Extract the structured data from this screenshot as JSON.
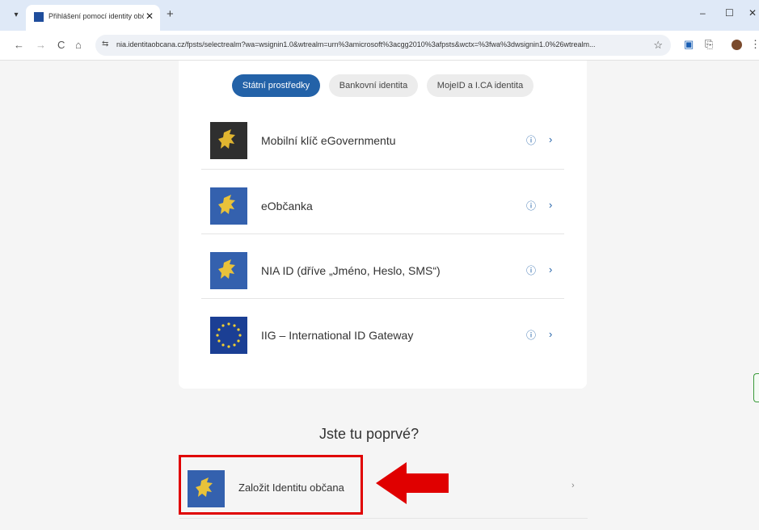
{
  "browser": {
    "tab_title": "Přihlášení pomocí identity obča",
    "tab_close": "✕",
    "new_tab": "+",
    "url": "nia.identitaobcana.cz/fpsts/selectrealm?wa=wsignin1.0&wtrealm=urn%3amicrosoft%3acgg2010%3afpsts&wctx=%3fwa%3dwsignin1.0%26wtrealm...",
    "win_min": "–",
    "win_max": "☐",
    "win_close": "✕",
    "tab_dropdown": "▾",
    "nav_back": "←",
    "nav_forward": "→",
    "nav_reload": "C",
    "nav_home": "⌂",
    "site_info": "⇆",
    "bookmark": "☆",
    "menu": "⋮",
    "ext_1": "▣",
    "ext_2": "⎘"
  },
  "page": {
    "tabs": [
      "Státní prostředky",
      "Bankovní identita",
      "MojeID a I.CA identita"
    ],
    "methods": [
      {
        "label": "Mobilní klíč eGovernmentu",
        "icon": "lion-emblem-dark"
      },
      {
        "label": "eObčanka",
        "icon": "lion-emblem-blue"
      },
      {
        "label": "NIA ID (dříve „Jméno, Heslo, SMS“)",
        "icon": "lion-emblem-blue"
      },
      {
        "label": "IIG – International ID Gateway",
        "icon": "eu-flag"
      }
    ],
    "info_icon": "ⓘ",
    "chevron": "›",
    "first_time_heading": "Jste tu poprvé?",
    "register_label": "Založit Identitu občana"
  },
  "colors": {
    "accent": "#2362a8",
    "highlight": "#e00000"
  }
}
